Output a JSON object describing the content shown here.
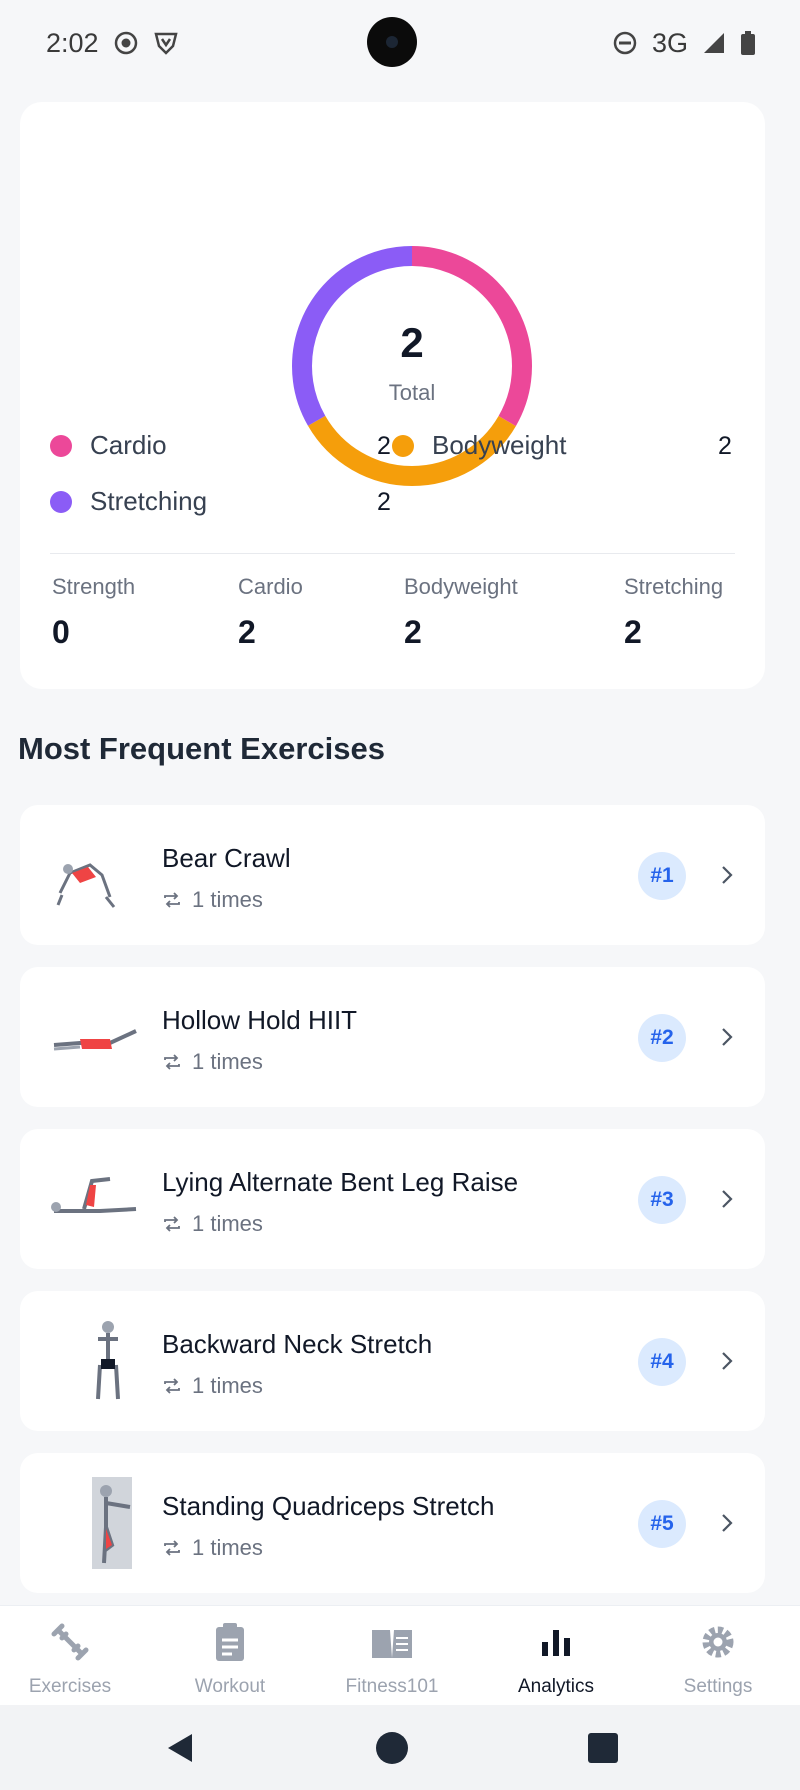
{
  "status_bar": {
    "time": "2:02",
    "network": "3G"
  },
  "summary": {
    "total": "2",
    "total_label": "Total",
    "legend": [
      {
        "label": "Cardio",
        "count": "2",
        "color": "#ec4899"
      },
      {
        "label": "Bodyweight",
        "count": "2",
        "color": "#f59e0b"
      },
      {
        "label": "Stretching",
        "count": "2",
        "color": "#8b5cf6"
      }
    ],
    "stats": [
      {
        "label": "Strength",
        "value": "0"
      },
      {
        "label": "Cardio",
        "value": "2"
      },
      {
        "label": "Bodyweight",
        "value": "2"
      },
      {
        "label": "Stretching",
        "value": "2"
      }
    ]
  },
  "section_title": "Most Frequent Exercises",
  "exercises": [
    {
      "name": "Bear Crawl",
      "times": "1 times",
      "rank": "#1",
      "icon": "bear-crawl-illustration"
    },
    {
      "name": "Hollow Hold HIIT",
      "times": "1 times",
      "rank": "#2",
      "icon": "hollow-hold-illustration"
    },
    {
      "name": "Lying Alternate Bent Leg Raise",
      "times": "1 times",
      "rank": "#3",
      "icon": "leg-raise-illustration"
    },
    {
      "name": "Backward Neck Stretch",
      "times": "1 times",
      "rank": "#4",
      "icon": "neck-stretch-illustration"
    },
    {
      "name": "Standing Quadriceps Stretch",
      "times": "1 times",
      "rank": "#5",
      "icon": "quad-stretch-illustration"
    }
  ],
  "bottom_nav": [
    {
      "label": "Exercises",
      "icon": "dumbbell-icon",
      "active": false
    },
    {
      "label": "Workout",
      "icon": "clipboard-icon",
      "active": false
    },
    {
      "label": "Fitness101",
      "icon": "book-icon",
      "active": false
    },
    {
      "label": "Analytics",
      "icon": "bar-chart-icon",
      "active": true
    },
    {
      "label": "Settings",
      "icon": "gear-icon",
      "active": false
    }
  ],
  "colors": {
    "accent": "#2563eb",
    "rank_bg": "#dbeafe"
  }
}
